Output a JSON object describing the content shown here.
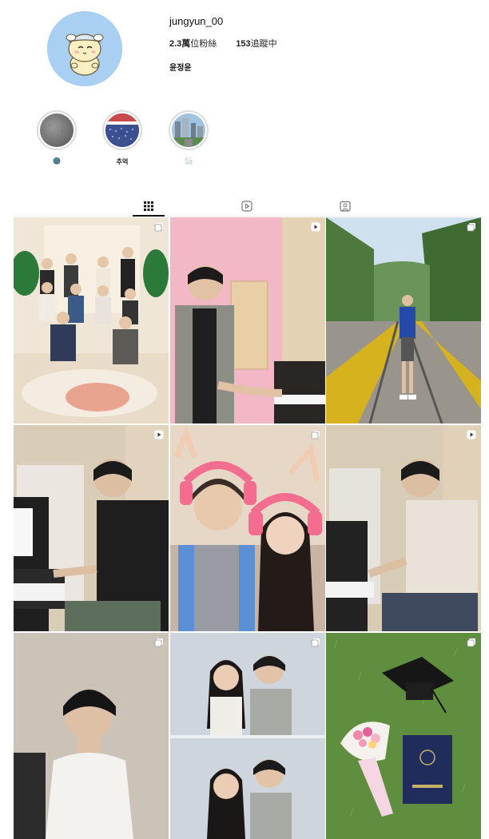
{
  "profile": {
    "username": "jungyun_00",
    "followers_count": "2.3萬",
    "followers_label": "位粉絲",
    "following_count": "153",
    "following_label": "追蹤中",
    "full_name": "윤정윤",
    "avatar": "cartoon-character-avatar"
  },
  "highlights": [
    {
      "label": "🌚",
      "cover": "gray-texture"
    },
    {
      "label": "추억",
      "cover": "stadium-crowd"
    },
    {
      "label": "🌫️",
      "cover": "city-street"
    }
  ],
  "tabs": [
    {
      "name": "posts",
      "icon": "grid-icon",
      "active": true
    },
    {
      "name": "reels",
      "icon": "reels-icon",
      "active": false
    },
    {
      "name": "tagged",
      "icon": "tagged-icon",
      "active": false
    }
  ],
  "posts": [
    {
      "subject": "group-photo-living-room",
      "badge": "multi-image-icon"
    },
    {
      "subject": "man-playing-piano-pink-room",
      "badge": "reel-icon"
    },
    {
      "subject": "man-on-railway-tracks",
      "badge": "multi-image-icon"
    },
    {
      "subject": "man-playing-piano-studio",
      "badge": "reel-icon"
    },
    {
      "subject": "couple-photobooth-pink-headphones",
      "badge": "multi-image-icon"
    },
    {
      "subject": "man-playing-piano-white-shirt",
      "badge": "reel-icon"
    },
    {
      "subject": "portrait-gray-background",
      "badge": "multi-image-icon"
    },
    {
      "subject": "couple-photobooth-strip",
      "badge": "multi-image-icon"
    },
    {
      "subject": "graduation-cap-flowers-on-grass",
      "badge": "multi-image-icon"
    }
  ],
  "colors": {
    "avatar_bg": "#a9cff2",
    "divider": "#ececec",
    "active_tab": "#111111"
  }
}
